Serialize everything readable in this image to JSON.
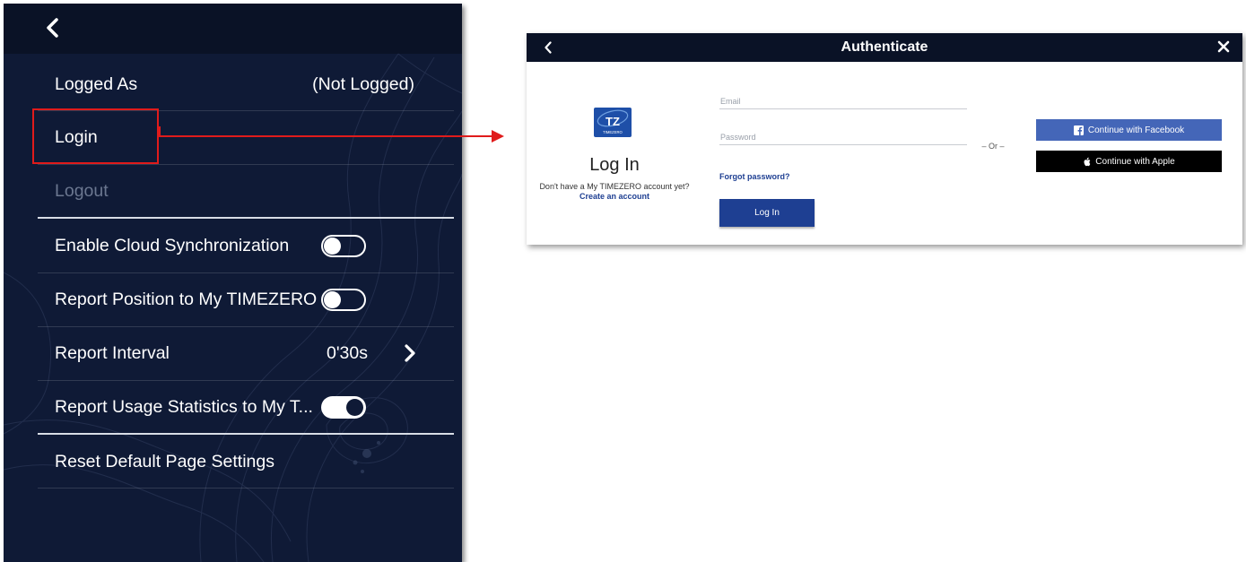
{
  "settings": {
    "rows": {
      "logged_as": {
        "label": "Logged As",
        "value": "(Not Logged)"
      },
      "login": {
        "label": "Login"
      },
      "logout": {
        "label": "Logout"
      },
      "cloud_sync": {
        "label": "Enable Cloud Synchronization",
        "enabled": false
      },
      "report_position": {
        "label": "Report Position to My TIMEZERO",
        "enabled": false
      },
      "report_interval": {
        "label": "Report Interval",
        "value": "0'30s"
      },
      "report_usage": {
        "label": "Report Usage Statistics to My T...",
        "enabled": true
      },
      "reset_defaults": {
        "label": "Reset Default Page Settings"
      }
    },
    "icons": {
      "back": "chevron-left-icon",
      "row_arrow": "chevron-right-icon"
    }
  },
  "annotation": {
    "highlight_color": "#e01b1b"
  },
  "dialog": {
    "title": "Authenticate",
    "logo_text": "TZ",
    "logo_subtext": "TIMEZERO",
    "heading": "Log In",
    "signup_prompt": "Don't have a My TIMEZERO account yet?",
    "signup_link": "Create an account",
    "email_placeholder": "Email",
    "password_placeholder": "Password",
    "forgot_password": "Forgot password?",
    "login_button": "Log In",
    "or_text": "– Or –",
    "facebook_button": "Continue with Facebook",
    "apple_button": "Continue with Apple",
    "colors": {
      "header": "#0a1226",
      "primary": "#1e3f92",
      "facebook": "#4466b8",
      "apple": "#000000"
    }
  }
}
